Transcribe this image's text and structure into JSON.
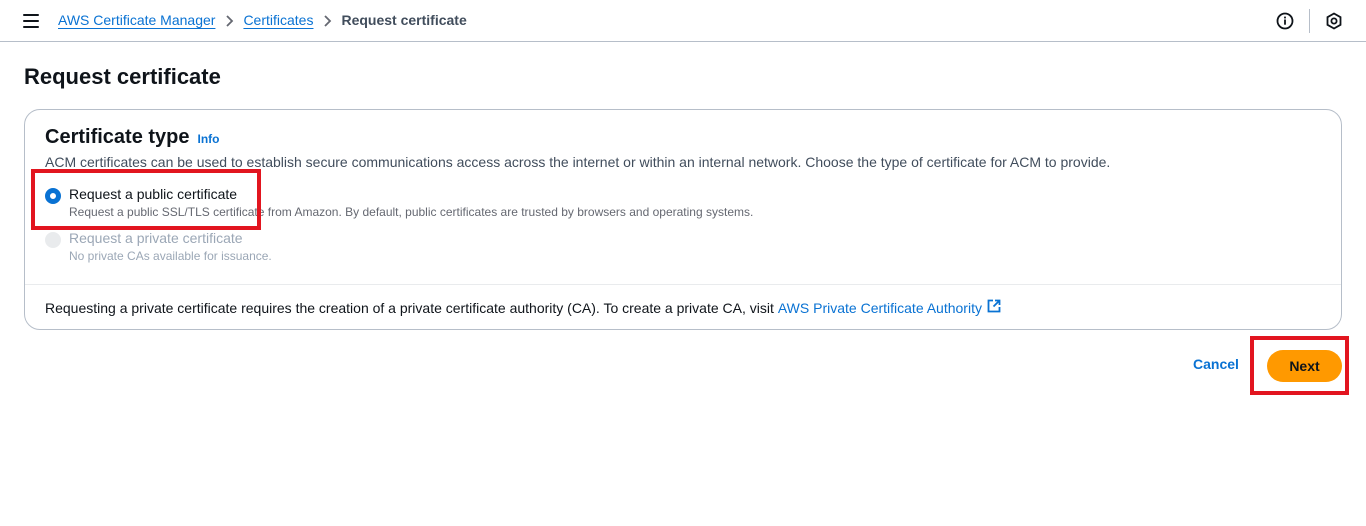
{
  "header": {
    "menu_icon": "hamburger-icon",
    "breadcrumb": {
      "items": [
        "AWS Certificate Manager",
        "Certificates"
      ],
      "current": "Request certificate"
    },
    "right_icons": [
      "info-circle-icon",
      "settings-hexagon-icon"
    ]
  },
  "page": {
    "title": "Request certificate"
  },
  "certificate_type": {
    "title": "Certificate type",
    "info_label": "Info",
    "description": "ACM certificates can be used to establish secure communications access across the internet or within an internal network. Choose the type of certificate for ACM to provide.",
    "options": [
      {
        "label": "Request a public certificate",
        "description": "Request a public SSL/TLS certificate from Amazon. By default, public certificates are trusted by browsers and operating systems.",
        "selected": true,
        "disabled": false
      },
      {
        "label": "Request a private certificate",
        "description": "No private CAs available for issuance.",
        "selected": false,
        "disabled": true
      }
    ],
    "footer_text": "Requesting a private certificate requires the creation of a private certificate authority (CA). To create a private CA, visit",
    "footer_link": "AWS Private Certificate Authority"
  },
  "actions": {
    "cancel_label": "Cancel",
    "next_label": "Next"
  },
  "colors": {
    "accent": "#0972d3",
    "primary_button": "#ff9900",
    "highlight": "#e2151f"
  }
}
